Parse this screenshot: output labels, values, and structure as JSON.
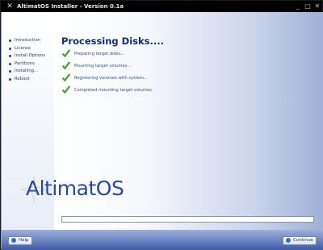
{
  "window": {
    "title": "AltimatOS Installer - Version 0.1a",
    "controls": [
      "minimize-icon",
      "maximize-icon",
      "close-icon"
    ]
  },
  "sidebar": {
    "steps": [
      {
        "label": "Introduction"
      },
      {
        "label": "License"
      },
      {
        "label": "Install Options"
      },
      {
        "label": "Partitions"
      },
      {
        "label": "Installing..."
      },
      {
        "label": "Reboot"
      }
    ]
  },
  "main": {
    "heading": "Processing Disks....",
    "tasks": [
      {
        "label": "Preparing target disks...",
        "status": "done"
      },
      {
        "label": "Mounting target volumes...",
        "status": "done"
      },
      {
        "label": "Registering volumes with system...",
        "status": "done"
      },
      {
        "label": "Completed mounting target volumes.",
        "status": "done"
      }
    ],
    "logo_text": "AltimatOS",
    "progress_fraction": 0.0
  },
  "footer": {
    "help_label": "Help",
    "continue_label": "Continue"
  },
  "colors": {
    "accent": "#0f2f7a",
    "check": "#3fae2a",
    "footer_bottom": "#3d5aa6"
  }
}
